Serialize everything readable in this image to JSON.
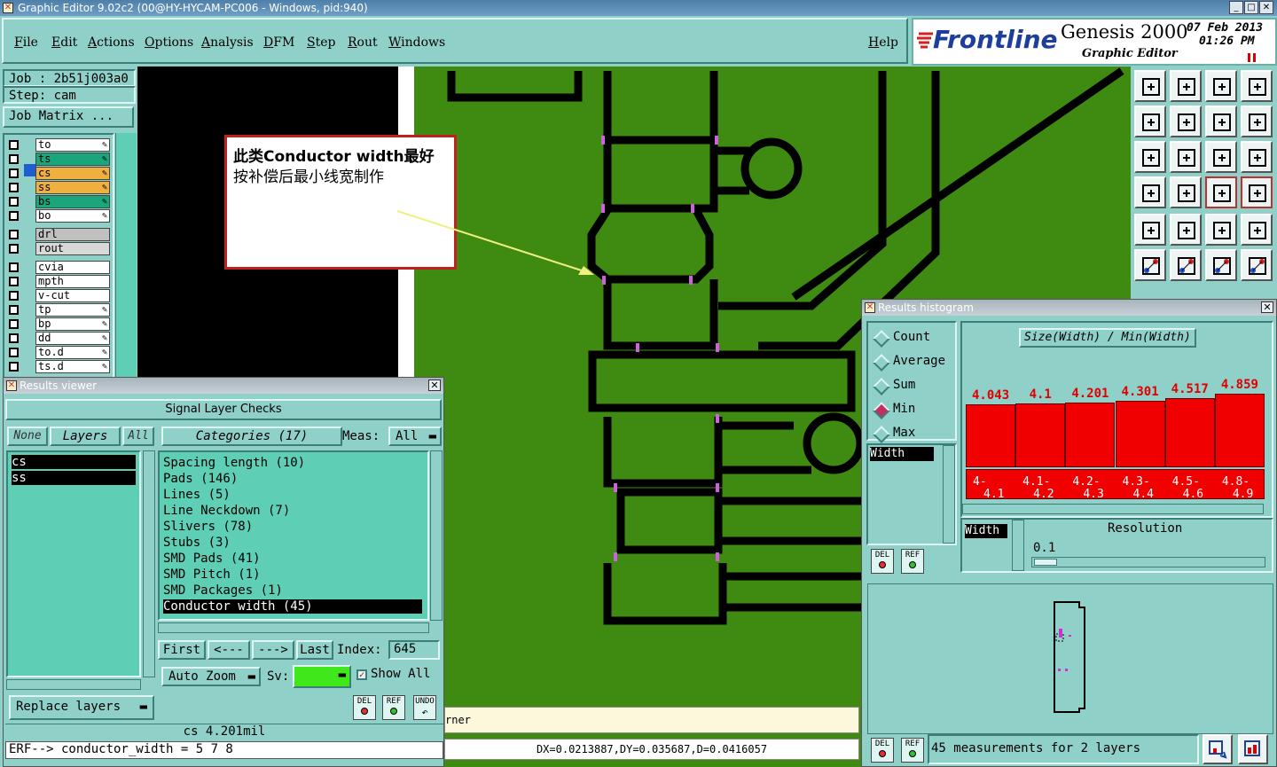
{
  "window": {
    "title": "Graphic Editor 9.02c2 (00@HY-HYCAM-PC006 - Windows, pid:940)"
  },
  "menu": {
    "items": [
      "File",
      "Edit",
      "Actions",
      "Options",
      "Analysis",
      "DFM",
      "Step",
      "Rout",
      "Windows"
    ],
    "help": "Help"
  },
  "brand": {
    "logo": "Frontline",
    "product": "Genesis 2000",
    "subtitle": "Graphic Editor",
    "date": "07 Feb 2013",
    "time": "01:26 PM"
  },
  "job": {
    "job_label": "Job : 2b51j003a0",
    "step_label": "Step: cam",
    "matrix_button": "Job Matrix ..."
  },
  "layers": [
    {
      "name": "to",
      "color": "#ffffff",
      "edit": true
    },
    {
      "name": "ts",
      "color": "#1aa57a",
      "edit": true
    },
    {
      "name": "cs",
      "color": "#f0b040",
      "edit": true,
      "active": true
    },
    {
      "name": "ss",
      "color": "#f0b040",
      "edit": true
    },
    {
      "name": "bs",
      "color": "#1aa57a",
      "edit": true
    },
    {
      "name": "bo",
      "color": "#ffffff",
      "edit": true
    },
    {
      "name": "drl",
      "color": "#c0c0c0",
      "edit": false
    },
    {
      "name": "rout",
      "color": "#d8d8d8",
      "edit": false
    },
    {
      "name": "cvia",
      "color": "#ffffff",
      "edit": false
    },
    {
      "name": "mpth",
      "color": "#ffffff",
      "edit": false
    },
    {
      "name": "v-cut",
      "color": "#ffffff",
      "edit": false
    },
    {
      "name": "tp",
      "color": "#ffffff",
      "edit": true
    },
    {
      "name": "bp",
      "color": "#ffffff",
      "edit": true
    },
    {
      "name": "dd",
      "color": "#ffffff",
      "edit": true
    },
    {
      "name": "to.d",
      "color": "#ffffff",
      "edit": true
    },
    {
      "name": "ts.d",
      "color": "#ffffff",
      "edit": true
    }
  ],
  "annotation": {
    "line1": "此类Conductor width最好",
    "line2": "按补偿后最小线宽制作"
  },
  "results_viewer": {
    "title": "Results viewer",
    "header": "Signal Layer Checks",
    "none_btn": "None",
    "layers_btn": "Layers",
    "all_btn": "All",
    "categories_btn": "Categories (17)",
    "meas_label": "Meas:",
    "meas_value": "All",
    "layer_list": [
      "cs",
      "ss"
    ],
    "categories": [
      "Spacing length (10)",
      "Pads (146)",
      "Lines (5)",
      "Line Neckdown (7)",
      "Slivers (78)",
      "Stubs (3)",
      "SMD Pads (41)",
      "SMD Pitch (1)",
      "SMD Packages (1)",
      "Conductor width (45)"
    ],
    "selected_category": "Conductor width (45)",
    "first_btn": "First",
    "prev_btn": "<---",
    "next_btn": "--->",
    "last_btn": "Last",
    "index_label": "Index:",
    "index_value": "645",
    "auto_zoom": "Auto Zoom",
    "sv_label": "Sv:",
    "show_all": "Show All",
    "replace_layers": "Replace layers",
    "del": "DEL",
    "ref": "REF",
    "undo": "UNDO",
    "status": "cs  4.201mil",
    "erf": "ERF--> conductor_width = 5 7 8"
  },
  "status_bar": {
    "hint": "rner",
    "coords": "DX=0.0213887,DY=0.035687,D=0.0416057"
  },
  "histogram": {
    "title": "Results histogram",
    "radios": [
      "Count",
      "Average",
      "Sum",
      "Min",
      "Max"
    ],
    "selected": "Min",
    "measure_item": "Width",
    "chart_title": "Size(Width) / Min(Width)",
    "bins": [
      {
        "value": 4.043,
        "label": "4.043",
        "range1": "4-",
        "range2": "4.1"
      },
      {
        "value": 4.1,
        "label": "4.1",
        "range1": "4.1-",
        "range2": "4.2"
      },
      {
        "value": 4.201,
        "label": "4.201",
        "range1": "4.2-",
        "range2": "4.3"
      },
      {
        "value": 4.301,
        "label": "4.301",
        "range1": "4.3-",
        "range2": "4.4"
      },
      {
        "value": 4.517,
        "label": "4.517",
        "range1": "4.5-",
        "range2": "4.6"
      },
      {
        "value": 4.859,
        "label": "4.859",
        "range1": "4.8-",
        "range2": "4.9"
      }
    ],
    "resolution_label": "Resolution",
    "resolution_value": "0.1",
    "width_label": "Width",
    "footer": "45 measurements for 2 layers",
    "del": "DEL",
    "ref": "REF"
  },
  "colors": {
    "board": "#3f8a10",
    "panel": "#8fd0c8",
    "bar": "#f00000",
    "highlight": "#d060e0"
  }
}
